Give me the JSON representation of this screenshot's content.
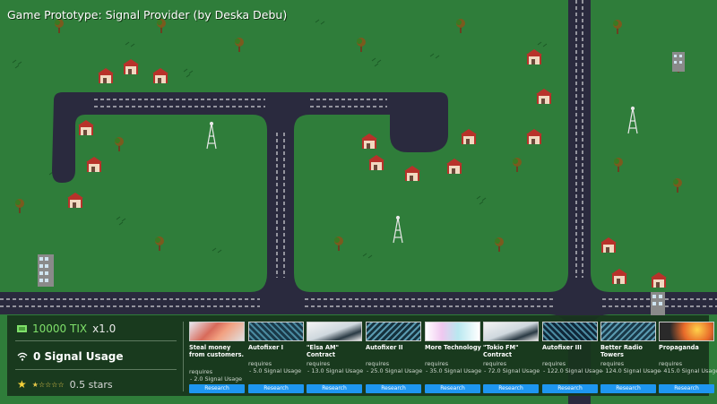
{
  "title": "Game Prototype: Signal Provider (by Deska Debu)",
  "stats": {
    "money": "10000 TIX",
    "multiplier": "x1.0",
    "signal_usage": "0 Signal Usage",
    "stars": "0.5 stars",
    "stars_rating": 0.5
  },
  "research": [
    {
      "name": "Steal money from customers.",
      "requires": "requires",
      "cost": "- 2.0 Signal Usage",
      "button": "Research"
    },
    {
      "name": "Autofixer I",
      "requires": "requires",
      "cost": "- 5.0 Signal Usage",
      "button": "Research"
    },
    {
      "name": "\"Elsa AM\" Contract",
      "requires": "requires",
      "cost": "- 13.0 Signal Usage",
      "button": "Research"
    },
    {
      "name": "Autofixer II",
      "requires": "requires",
      "cost": "- 25.0 Signal Usage",
      "button": "Research"
    },
    {
      "name": "More Technology",
      "requires": "requires",
      "cost": "- 35.0 Signal Usage",
      "button": "Research"
    },
    {
      "name": "\"Tokio FM\" Contract",
      "requires": "requires",
      "cost": "- 72.0 Signal Usage",
      "button": "Research"
    },
    {
      "name": "Autofixer III",
      "requires": "requires",
      "cost": "- 122.0 Signal Usage",
      "button": "Research"
    },
    {
      "name": "Better Radio Towers",
      "requires": "requires",
      "cost": "- 124.0 Signal Usage",
      "button": "Research"
    },
    {
      "name": "Propaganda",
      "requires": "requires",
      "cost": "- 415.0 Signal Usage",
      "button": "Research"
    }
  ],
  "colors": {
    "grass": "#2f7d3a",
    "road": "#2a2a3e",
    "house_roof": "#b8322a",
    "house_wall": "#f1d9c0",
    "money": "#7fe06a",
    "button": "#1e96f0"
  }
}
